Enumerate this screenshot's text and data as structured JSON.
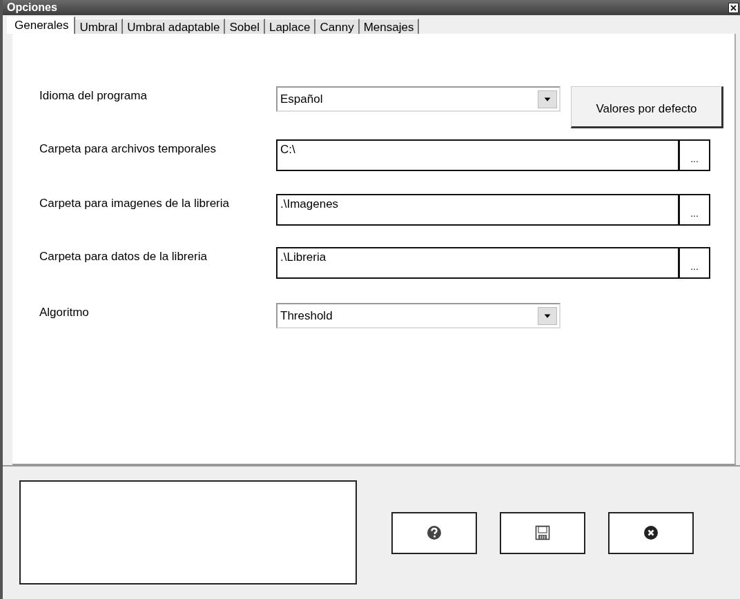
{
  "window": {
    "title": "Opciones"
  },
  "tabs": [
    {
      "label": "Generales",
      "selected": true
    },
    {
      "label": "Umbral",
      "selected": false
    },
    {
      "label": "Umbral adaptable",
      "selected": false
    },
    {
      "label": "Sobel",
      "selected": false
    },
    {
      "label": "Laplace",
      "selected": false
    },
    {
      "label": "Canny",
      "selected": false
    },
    {
      "label": "Mensajes",
      "selected": false
    }
  ],
  "form": [
    {
      "kind": "combo",
      "label": "Idioma del programa",
      "value": "Español",
      "button": "Valores por defecto"
    },
    {
      "kind": "path",
      "label": "Carpeta para archivos temporales",
      "value": "C:\\",
      "button": "..."
    },
    {
      "kind": "path",
      "label": "Carpeta para imagenes de la libreria",
      "value": ".\\Imagenes",
      "button": "..."
    },
    {
      "kind": "path",
      "label": "Carpeta para datos de la libreria",
      "value": ".\\Libreria",
      "button": "..."
    },
    {
      "kind": "combo",
      "label": "Algoritmo",
      "value": "Threshold"
    }
  ],
  "buttons": [
    {
      "kind": "help"
    },
    {
      "kind": "save"
    },
    {
      "kind": "close"
    }
  ]
}
